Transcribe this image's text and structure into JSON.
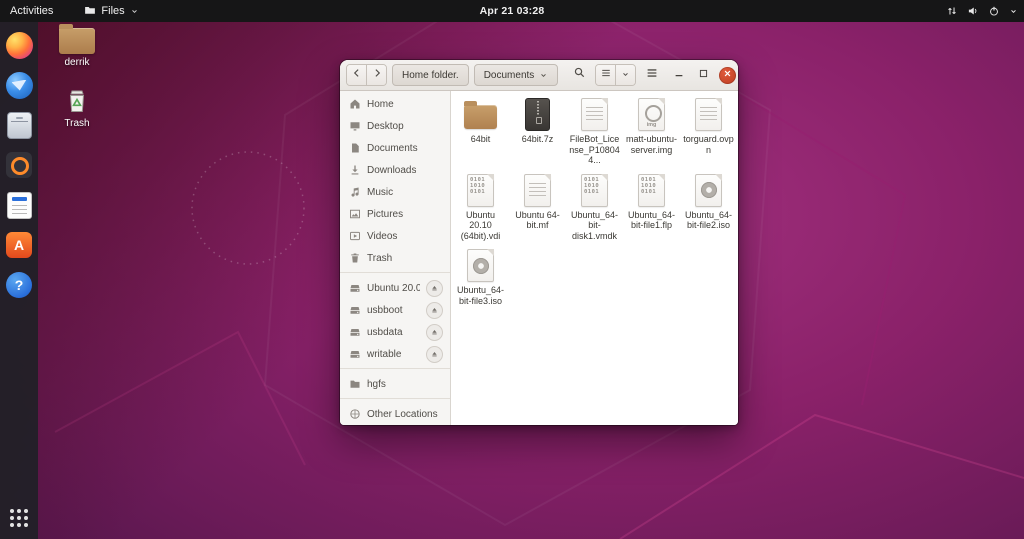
{
  "top_bar": {
    "activities": "Activities",
    "app_menu": "Files",
    "clock": "Apr 21 03:28",
    "status_icons": [
      "network-arrows-icon",
      "volume-icon",
      "power-icon",
      "chevron-down-icon"
    ]
  },
  "dock": {
    "items": [
      {
        "id": "firefox"
      },
      {
        "id": "thunderbird"
      },
      {
        "id": "files"
      },
      {
        "id": "rhythmbox"
      },
      {
        "id": "libreoffice-writer"
      },
      {
        "id": "ubuntu-software",
        "glyph": "A"
      },
      {
        "id": "help",
        "glyph": "?"
      }
    ]
  },
  "desktop": {
    "icons": [
      {
        "label": "derrik",
        "icon": "folder-icon"
      },
      {
        "label": "Trash",
        "icon": "trash-icon"
      }
    ]
  },
  "window": {
    "toolbar": {
      "home_button": "Home folder.",
      "location_button": "Documents"
    },
    "sidebar": {
      "sections": [
        {
          "items": [
            {
              "label": "Home",
              "icon": "home-icon"
            },
            {
              "label": "Desktop",
              "icon": "desktop-icon"
            },
            {
              "label": "Documents",
              "icon": "document-icon"
            },
            {
              "label": "Downloads",
              "icon": "download-icon"
            },
            {
              "label": "Music",
              "icon": "music-icon"
            },
            {
              "label": "Pictures",
              "icon": "image-icon"
            },
            {
              "label": "Videos",
              "icon": "video-icon"
            },
            {
              "label": "Trash",
              "icon": "trash-icon"
            }
          ]
        },
        {
          "items": [
            {
              "label": "Ubuntu 20.0...",
              "icon": "drive-icon",
              "eject": true
            },
            {
              "label": "usbboot",
              "icon": "drive-icon",
              "eject": true
            },
            {
              "label": "usbdata",
              "icon": "drive-icon",
              "eject": true
            },
            {
              "label": "writable",
              "icon": "drive-icon",
              "eject": true
            }
          ]
        },
        {
          "items": [
            {
              "label": "hgfs",
              "icon": "folder-icon"
            }
          ]
        },
        {
          "items": [
            {
              "label": "Other Locations",
              "icon": "other-locations-icon"
            }
          ]
        }
      ]
    },
    "files": [
      {
        "name": "64bit",
        "type": "folder"
      },
      {
        "name": "64bit.7z",
        "type": "archive"
      },
      {
        "name": "FileBot_License_P108044...",
        "type": "text"
      },
      {
        "name": "matt-ubuntu-server.img",
        "type": "image"
      },
      {
        "name": "torguard.ovpn",
        "type": "text"
      },
      {
        "name": "Ubuntu 20.10 (64bit).vdi",
        "type": "binary"
      },
      {
        "name": "Ubuntu 64-bit.mf",
        "type": "text"
      },
      {
        "name": "Ubuntu_64-bit-disk1.vmdk",
        "type": "binary"
      },
      {
        "name": "Ubuntu_64-bit-file1.flp",
        "type": "binary"
      },
      {
        "name": "Ubuntu_64-bit-file2.iso",
        "type": "iso"
      },
      {
        "name": "Ubuntu_64-bit-file3.iso",
        "type": "iso"
      }
    ],
    "colors": {
      "accent_orange": "#e2491d",
      "close_button": "#bd3c20",
      "folder_tan": "#b08150",
      "headerbar": "#efece9",
      "sidebar_bg": "#f6f5f3"
    }
  }
}
